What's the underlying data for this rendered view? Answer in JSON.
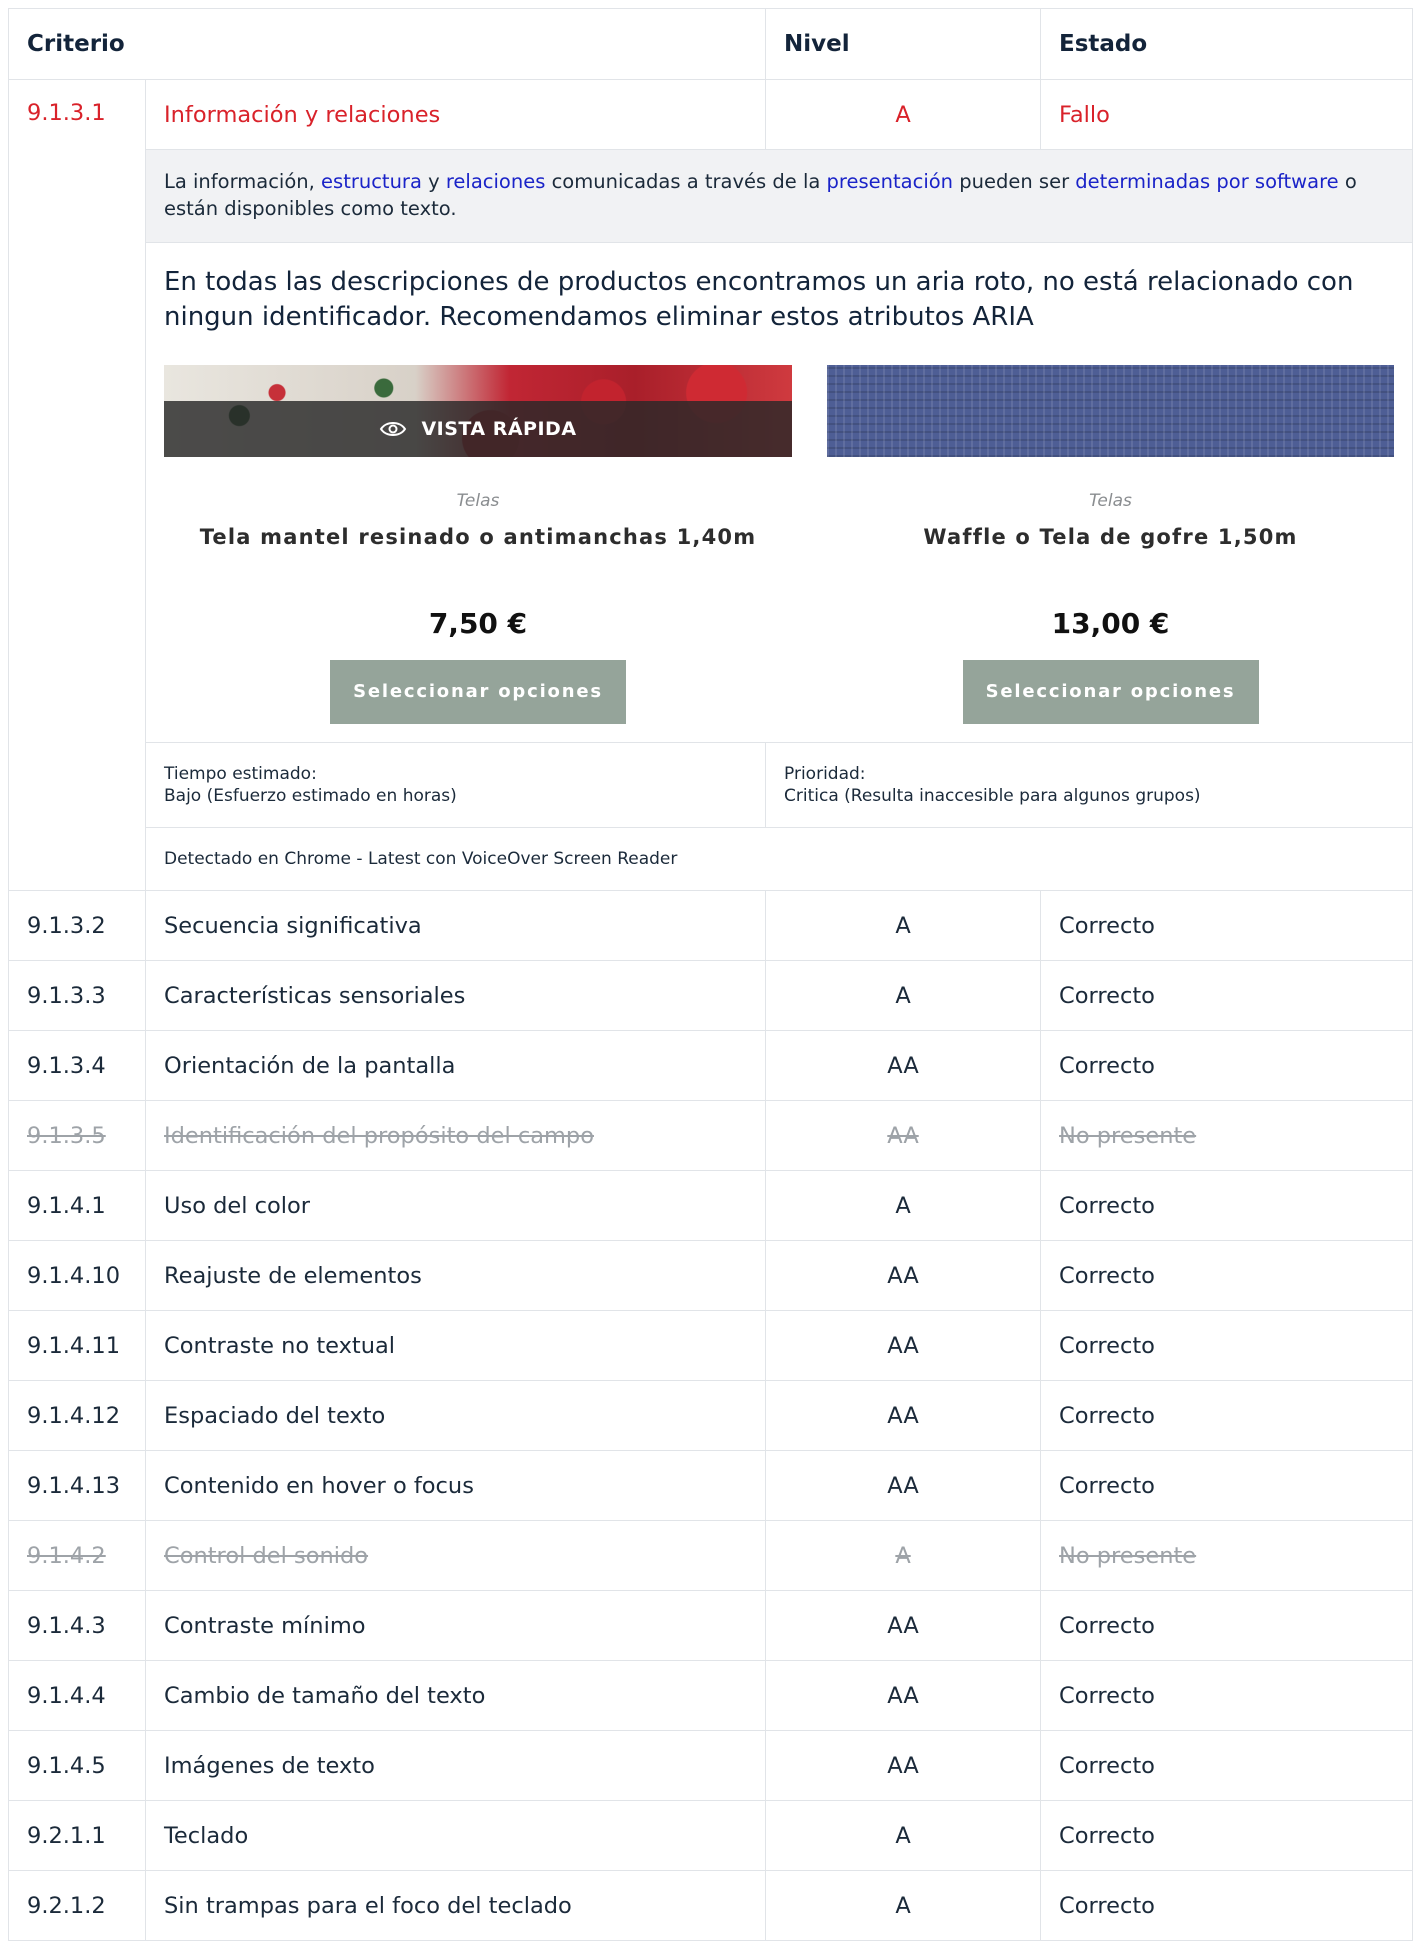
{
  "header": {
    "criterio": "Criterio",
    "nivel": "Nivel",
    "estado": "Estado"
  },
  "failed": {
    "id": "9.1.3.1",
    "name": "Información y relaciones",
    "level": "A",
    "status": "Fallo",
    "description": {
      "t1": "La información, ",
      "l1": "estructura",
      "t2": " y ",
      "l2": "relaciones",
      "t3": " comunicadas a través de la ",
      "l3": "presentación",
      "t4": " pueden ser ",
      "l4": "determinadas por software",
      "t5": " o están disponibles como texto."
    },
    "note": "En todas las descripciones de productos encontramos un aria roto, no está relacionado con ningun identificador. Recomendamos eliminar estos atributos ARIA",
    "products": [
      {
        "quick_view": "VISTA RÁPIDA",
        "category": "Telas",
        "name": "Tela mantel resinado o antimanchas 1,40m",
        "price": "7,50 €",
        "button": "Seleccionar opciones"
      },
      {
        "category": "Telas",
        "name": "Waffle o Tela de gofre 1,50m",
        "price": "13,00 €",
        "button": "Seleccionar opciones"
      }
    ],
    "time_label": "Tiempo estimado:",
    "time_value": "Bajo (Esfuerzo estimado en horas)",
    "priority_label": "Prioridad:",
    "priority_value": "Critica (Resulta inaccesible para algunos grupos)",
    "detected": "Detectado en Chrome - Latest con VoiceOver Screen Reader"
  },
  "rows": [
    {
      "id": "9.1.3.2",
      "name": "Secuencia significativa",
      "level": "A",
      "status": "Correcto"
    },
    {
      "id": "9.1.3.3",
      "name": "Características sensoriales",
      "level": "A",
      "status": "Correcto"
    },
    {
      "id": "9.1.3.4",
      "name": "Orientación de la pantalla",
      "level": "AA",
      "status": "Correcto"
    },
    {
      "id": "9.1.3.5",
      "name": "Identificación del propósito del campo",
      "level": "AA",
      "status": "No presente"
    },
    {
      "id": "9.1.4.1",
      "name": "Uso del color",
      "level": "A",
      "status": "Correcto"
    },
    {
      "id": "9.1.4.10",
      "name": "Reajuste de elementos",
      "level": "AA",
      "status": "Correcto"
    },
    {
      "id": "9.1.4.11",
      "name": "Contraste no textual",
      "level": "AA",
      "status": "Correcto"
    },
    {
      "id": "9.1.4.12",
      "name": "Espaciado del texto",
      "level": "AA",
      "status": "Correcto"
    },
    {
      "id": "9.1.4.13",
      "name": "Contenido en hover o focus",
      "level": "AA",
      "status": "Correcto"
    },
    {
      "id": "9.1.4.2",
      "name": "Control del sonido",
      "level": "A",
      "status": "No presente"
    },
    {
      "id": "9.1.4.3",
      "name": "Contraste mínimo",
      "level": "AA",
      "status": "Correcto"
    },
    {
      "id": "9.1.4.4",
      "name": "Cambio de tamaño del texto",
      "level": "AA",
      "status": "Correcto"
    },
    {
      "id": "9.1.4.5",
      "name": "Imágenes de texto",
      "level": "AA",
      "status": "Correcto"
    },
    {
      "id": "9.2.1.1",
      "name": "Teclado",
      "level": "A",
      "status": "Correcto"
    },
    {
      "id": "9.2.1.2",
      "name": "Sin trampas para el foco del teclado",
      "level": "A",
      "status": "Correcto"
    }
  ],
  "colors": {
    "fail": "#d9222a",
    "link": "#1a23c8",
    "not_present": "#9ea3a8",
    "button": "#95a49a"
  }
}
